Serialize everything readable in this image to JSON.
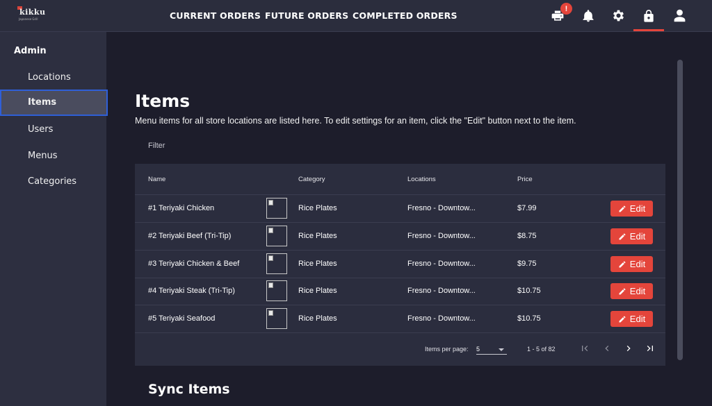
{
  "logo": {
    "title": "kikku",
    "subtitle": "Japanese Grill"
  },
  "nav": {
    "current": "CURRENT ORDERS",
    "future": "FUTURE ORDERS",
    "completed": "COMPLETED ORDERS"
  },
  "toolbar": {
    "printer_badge": "!",
    "icons": [
      "printer-icon",
      "bell-icon",
      "gear-icon",
      "lock-icon",
      "user-icon"
    ],
    "active_icon": "lock-icon"
  },
  "sidebar": {
    "heading": "Admin",
    "items": [
      "Locations",
      "Items",
      "Users",
      "Menus",
      "Categories"
    ],
    "active": "Items"
  },
  "main": {
    "title": "Items",
    "description": "Menu items for all store locations are listed here. To edit settings for an item, click the \"Edit\" button next to the item.",
    "filter_placeholder": "Filter",
    "sync_title": "Sync Items"
  },
  "table": {
    "columns": {
      "name": "Name",
      "category": "Category",
      "locations": "Locations",
      "price": "Price"
    },
    "edit_label": "Edit",
    "rows": [
      {
        "name": "#1 Teriyaki Chicken",
        "category": "Rice Plates",
        "locations": "Fresno - Downtow...",
        "price": "$7.99"
      },
      {
        "name": "#2 Teriyaki Beef (Tri-Tip)",
        "category": "Rice Plates",
        "locations": "Fresno - Downtow...",
        "price": "$8.75"
      },
      {
        "name": "#3 Teriyaki Chicken & Beef",
        "category": "Rice Plates",
        "locations": "Fresno - Downtow...",
        "price": "$9.75"
      },
      {
        "name": "#4 Teriyaki Steak (Tri-Tip)",
        "category": "Rice Plates",
        "locations": "Fresno - Downtow...",
        "price": "$10.75"
      },
      {
        "name": "#5 Teriyaki Seafood",
        "category": "Rice Plates",
        "locations": "Fresno - Downtow...",
        "price": "$10.75"
      }
    ]
  },
  "pagination": {
    "items_per_page_label": "Items per page:",
    "items_per_page": "5",
    "range": "1 - 5 of 82"
  },
  "colors": {
    "accent": "#e4453b",
    "sidebar_active_border": "#2f5fd8",
    "background": "#1d1d2b",
    "panel": "#2b2d3e"
  }
}
